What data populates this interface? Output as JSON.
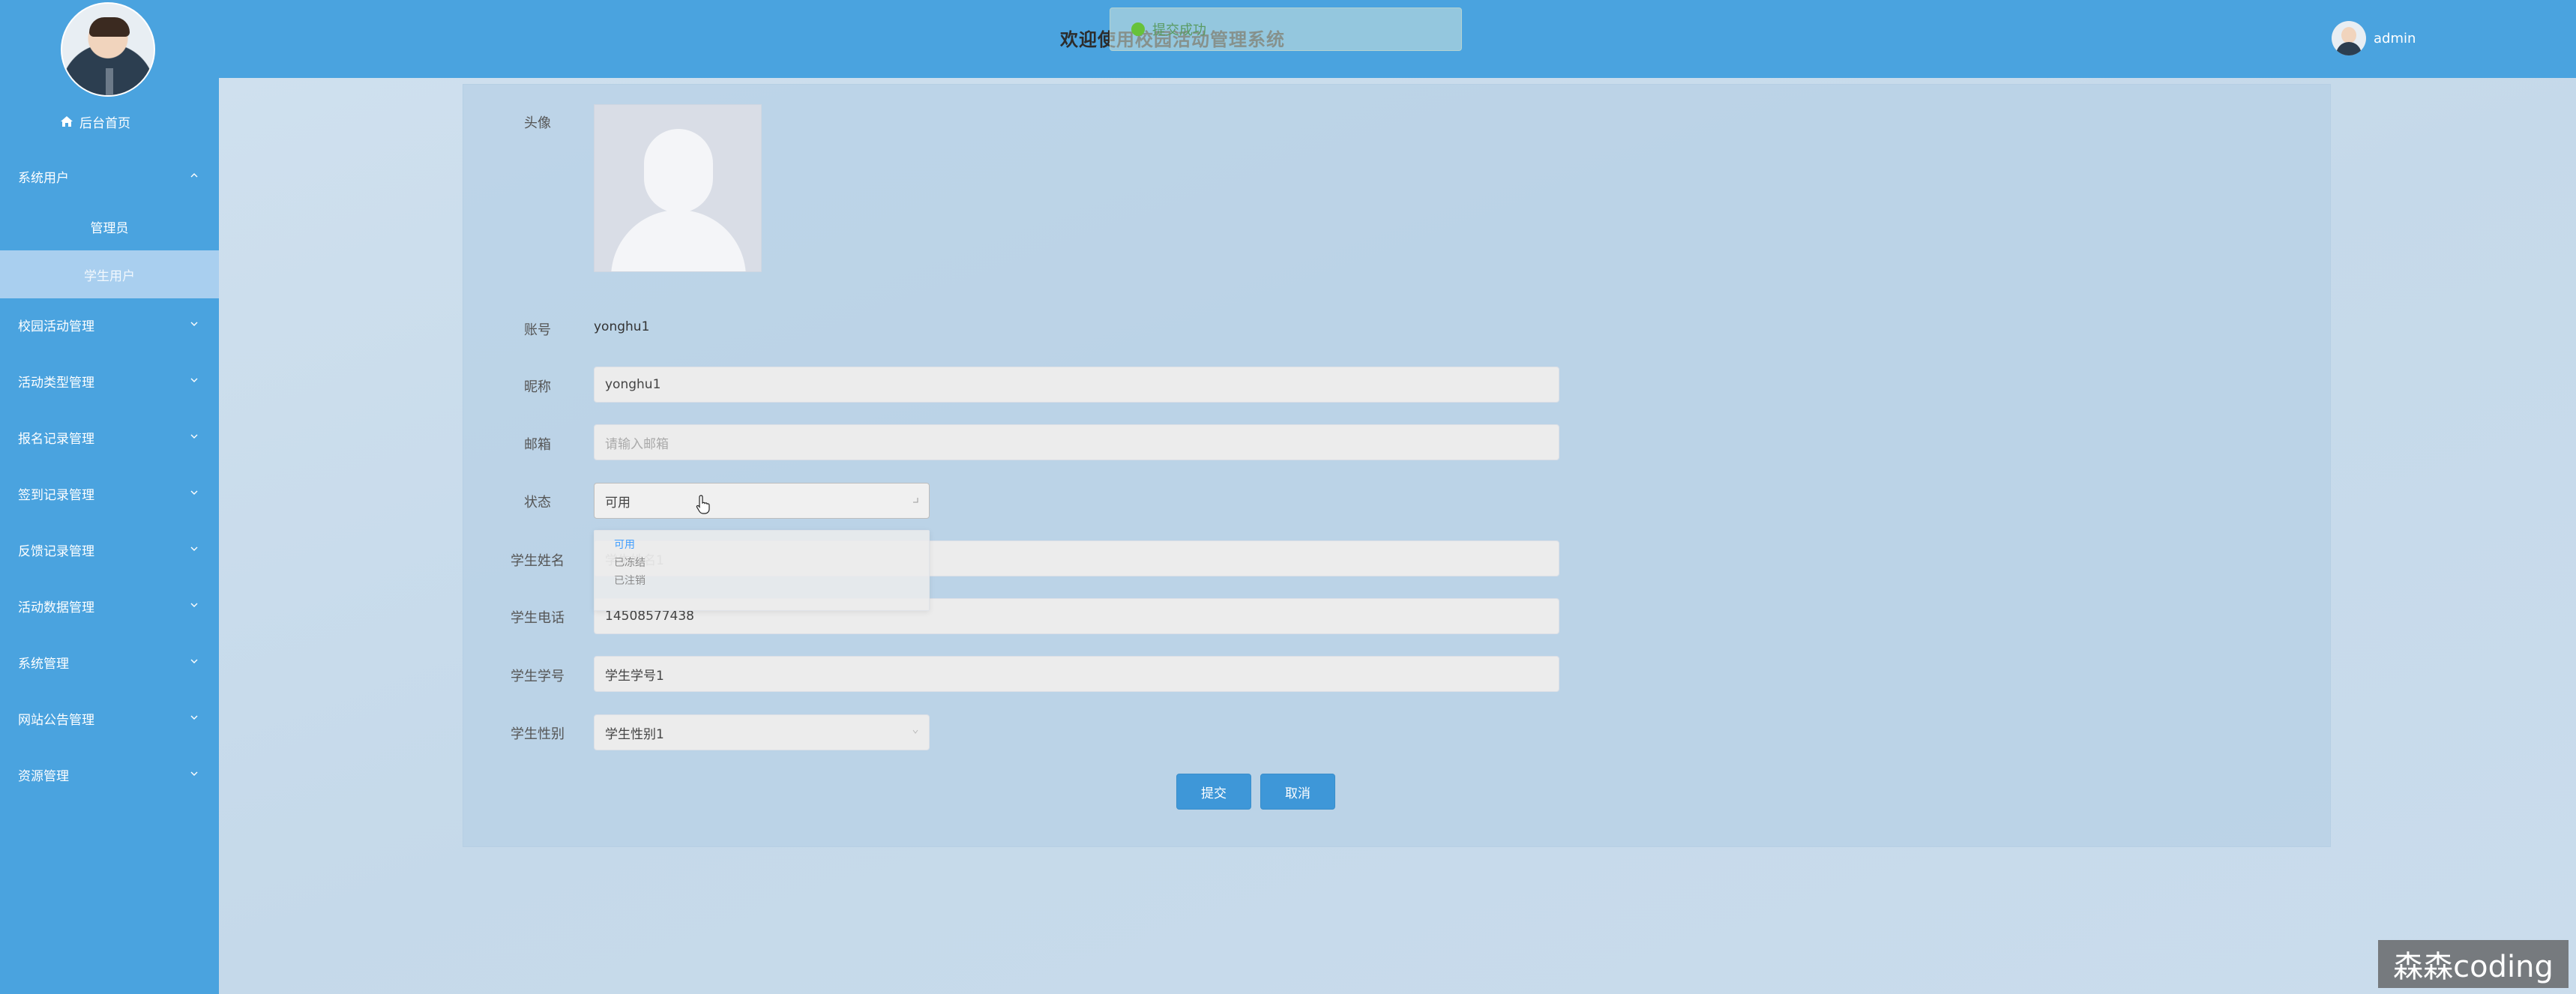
{
  "header": {
    "title": "欢迎使用校园活动管理系统",
    "toast": "提交成功",
    "username": "admin"
  },
  "sidebar": {
    "home": "后台首页",
    "items": [
      {
        "label": "系统用户",
        "expanded": true
      },
      {
        "label": "校园活动管理"
      },
      {
        "label": "活动类型管理"
      },
      {
        "label": "报名记录管理"
      },
      {
        "label": "签到记录管理"
      },
      {
        "label": "反馈记录管理"
      },
      {
        "label": "活动数据管理"
      },
      {
        "label": "系统管理"
      },
      {
        "label": "网站公告管理"
      },
      {
        "label": "资源管理"
      }
    ],
    "subitems": [
      {
        "label": "管理员"
      },
      {
        "label": "学生用户",
        "active": true
      }
    ]
  },
  "form": {
    "avatar_label": "头像",
    "account_label": "账号",
    "account_value": "yonghu1",
    "nickname_label": "昵称",
    "nickname_value": "yonghu1",
    "email_label": "邮箱",
    "email_placeholder": "请输入邮箱",
    "status_label": "状态",
    "status_value": "可用",
    "status_options": [
      "可用",
      "已冻结",
      "已注销"
    ],
    "name_label": "学生姓名",
    "name_value": "学生姓名1",
    "phone_label": "学生电话",
    "phone_value": "14508577438",
    "id_label": "学生学号",
    "id_value": "学生学号1",
    "gender_label": "学生性别",
    "gender_value": "学生性别1",
    "submit": "提交",
    "cancel": "取消"
  },
  "watermark": "森森coding",
  "colors": {
    "sidebar": "#4aa3df",
    "active_sub": "#a9cfef",
    "button": "#3e97d8"
  }
}
